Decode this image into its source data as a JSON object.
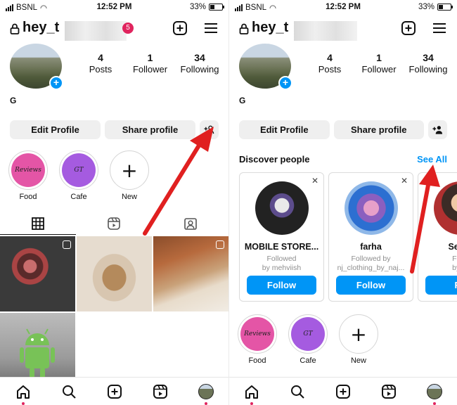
{
  "status_bar": {
    "carrier": "BSNL",
    "time": "12:52 PM",
    "battery": "33%",
    "battery_level": 0.33
  },
  "profile": {
    "username": "hey_t",
    "notification_count": "5",
    "display_name": "G",
    "stats": [
      {
        "value": "4",
        "label": "Posts"
      },
      {
        "value": "1",
        "label": "Follower"
      },
      {
        "value": "34",
        "label": "Following"
      }
    ]
  },
  "buttons": {
    "edit_profile": "Edit Profile",
    "share_profile": "Share profile"
  },
  "highlights": [
    {
      "label": "Food",
      "cover_text": "Reviews",
      "color": "#e455a6"
    },
    {
      "label": "Cafe",
      "cover_text": "GT",
      "color": "#a55be0"
    },
    {
      "label": "New",
      "cover_text": "+"
    }
  ],
  "discover": {
    "title": "Discover people",
    "see_all": "See All",
    "cards": [
      {
        "name": "MOBILE STORE...",
        "line1": "Followed",
        "line2": "by mehviish",
        "button": "Follow"
      },
      {
        "name": "farha",
        "line1": "Followed by",
        "line2": "nj_clothing_by_naj...",
        "button": "Follow"
      },
      {
        "name": "Semo",
        "line1": "Follo",
        "line2": "by m",
        "button": "Fo"
      }
    ]
  },
  "colors": {
    "accent": "#0095f6",
    "badge": "#e0245e",
    "arrow": "#e02020"
  },
  "icons": [
    "lock-icon",
    "new-post-icon",
    "menu-icon",
    "discover-people-icon",
    "grid-icon",
    "reels-icon",
    "tagged-icon",
    "home-icon",
    "search-icon",
    "create-icon",
    "reels-nav-icon",
    "profile-nav-icon"
  ]
}
